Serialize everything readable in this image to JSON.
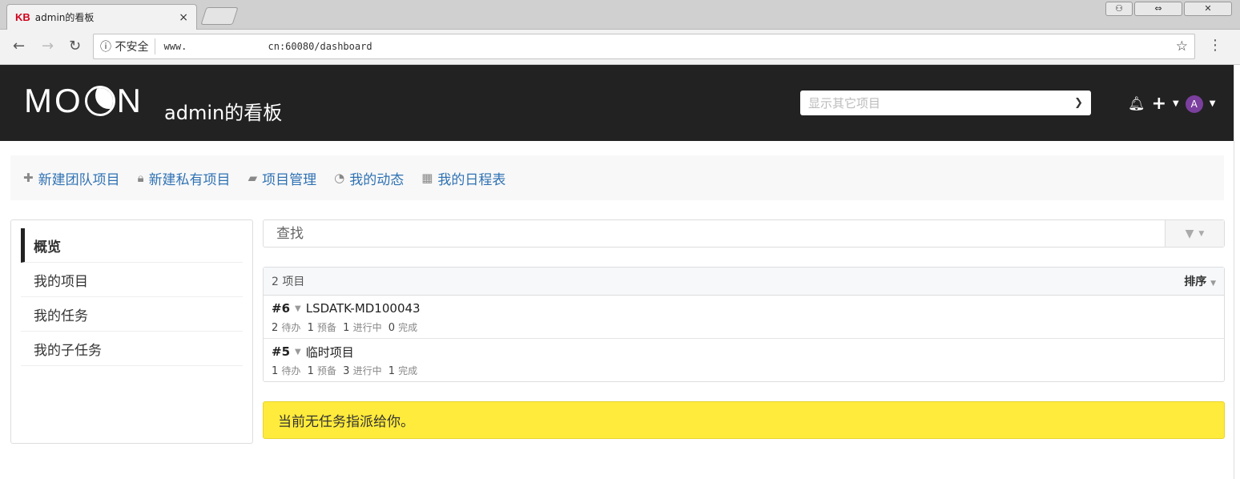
{
  "browser": {
    "tab_favicon": "KB",
    "tab_title": "admin的看板",
    "tab_close": "×",
    "security_label": "ⓘ 不安全",
    "url": "www.              cn:60080/dashboard",
    "win_user": "⚇",
    "win_resize": "⇔",
    "win_close": "✕"
  },
  "header": {
    "logo_left": "MO",
    "logo_right": "N",
    "board_title": "admin的看板",
    "project_select_placeholder": "显示其它项目",
    "avatar_letter": "A"
  },
  "quicklinks": [
    {
      "icon": "plus-icon",
      "label": "新建团队项目"
    },
    {
      "icon": "lock-icon",
      "label": "新建私有项目"
    },
    {
      "icon": "folder-icon",
      "label": "项目管理"
    },
    {
      "icon": "dashboard-icon",
      "label": "我的动态"
    },
    {
      "icon": "calendar-icon",
      "label": "我的日程表"
    }
  ],
  "sidebar": {
    "items": [
      "概览",
      "我的项目",
      "我的任务",
      "我的子任务"
    ],
    "active": "概览"
  },
  "search": {
    "placeholder": "查找"
  },
  "projects": {
    "count_label": "2 项目",
    "sort_label": "排序",
    "rows": [
      {
        "id": "#6",
        "name": "LSDATK-MD100043",
        "todo": "2",
        "todo_label": "待办",
        "ready": "1",
        "ready_label": "预备",
        "doing": "1",
        "doing_label": "进行中",
        "done": "0",
        "done_label": "完成"
      },
      {
        "id": "#5",
        "name": "临时项目",
        "todo": "1",
        "todo_label": "待办",
        "ready": "1",
        "ready_label": "预备",
        "doing": "3",
        "doing_label": "进行中",
        "done": "1",
        "done_label": "完成"
      }
    ]
  },
  "alert": {
    "text": "当前无任务指派给你。"
  },
  "colors": {
    "header_bg": "#222222",
    "link": "#3072b3",
    "alert_bg": "#ffeb3b",
    "avatar": "#7b3f9e"
  }
}
